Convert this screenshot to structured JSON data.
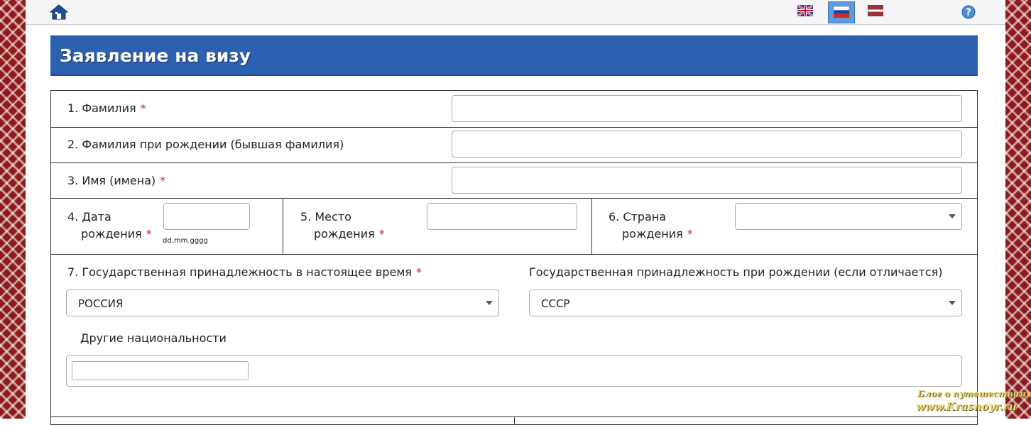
{
  "header": {
    "title": "Заявление на визу"
  },
  "languages": [
    {
      "code": "en",
      "icon": "uk-flag-icon"
    },
    {
      "code": "ru",
      "icon": "russia-flag-icon",
      "selected": true
    },
    {
      "code": "lv",
      "icon": "latvia-flag-icon"
    }
  ],
  "form": {
    "surname": {
      "label": "1. Фамилия",
      "required": "*",
      "value": ""
    },
    "surname_at_birth": {
      "label": "2. Фамилия при рождении (бывшая фамилия)",
      "value": ""
    },
    "first_names": {
      "label": "3. Имя (имена)",
      "required": "*",
      "value": ""
    },
    "birth_date": {
      "label_line1": "4. Дата",
      "label_line2": "рождения",
      "required": "*",
      "value": "",
      "hint": "dd.mm.gggg"
    },
    "birth_place": {
      "label_line1": "5. Место",
      "label_line2": "рождения",
      "required": "*",
      "value": ""
    },
    "birth_country": {
      "label_line1": "6. Страна",
      "label_line2": "рождения",
      "required": "*",
      "value": ""
    },
    "current_nationality": {
      "label": "7. Государственная принадлежность в настоящее время",
      "required": "*",
      "value": "РОССИЯ"
    },
    "nationality_at_birth": {
      "label": "Государственная принадлежность при рождении (если отличается)",
      "value": "СССР"
    },
    "other_nationalities": {
      "label": "Другие национальности",
      "value": ""
    }
  },
  "watermark": {
    "line1": "Блог о путешествиях",
    "line2": "www.Krasnoyr.ru"
  },
  "colors": {
    "header_bg": "#2c60b0",
    "required": "#d41e1e",
    "border_pattern": "#8e1b1b"
  }
}
